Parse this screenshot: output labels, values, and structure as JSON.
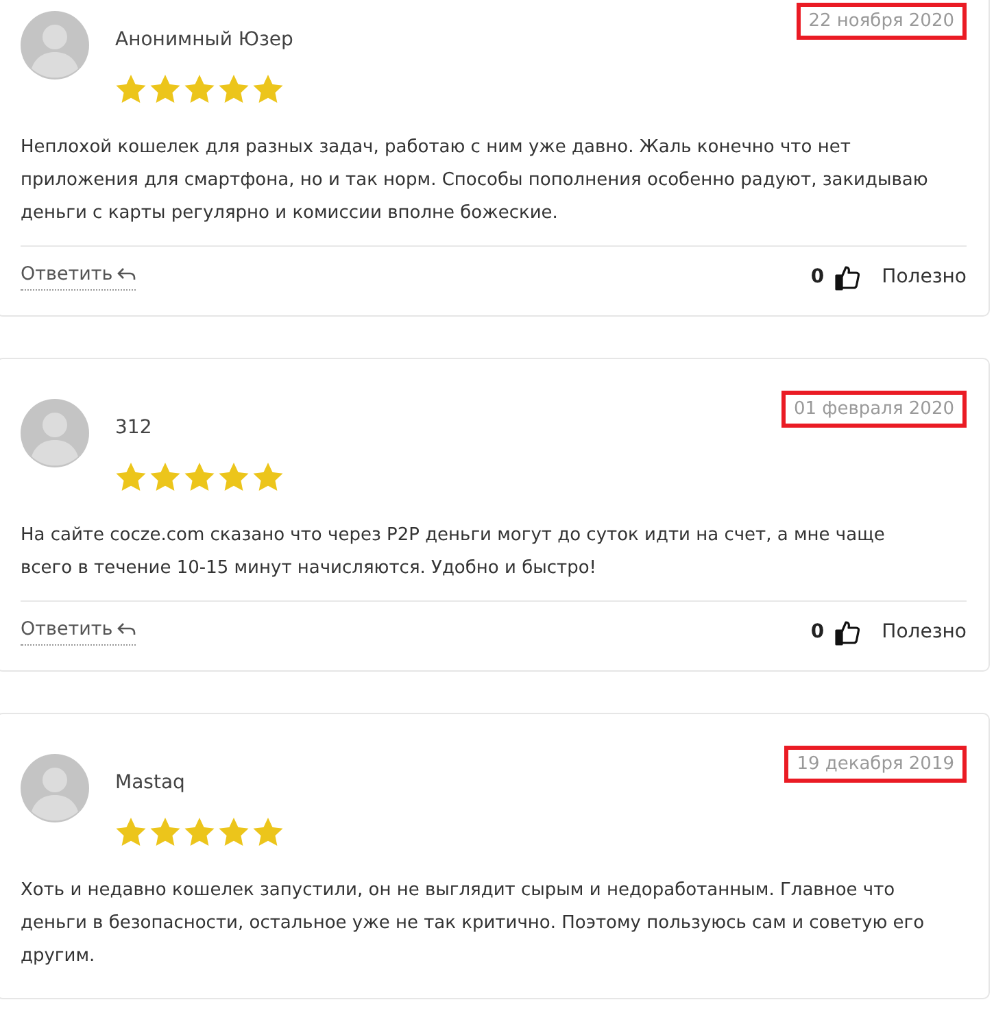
{
  "reviews": [
    {
      "author": "Анонимный Юзер",
      "date": "22 ноября 2020",
      "date_highlighted": true,
      "stars": 5,
      "text": "Неплохой кошелек для разных задач, работаю с ним уже давно. Жаль конечно что нет приложения для смартфона, но и так норм. Способы пополнения особенно радуют, закидываю деньги с карты регулярно и комиссии вполне божеские.",
      "reply": "Ответить",
      "likes": "0",
      "helpful": "Полезно"
    },
    {
      "author": "312",
      "date": "01 февраля 2020",
      "date_highlighted": true,
      "stars": 5,
      "text": "На сайте cocze.com сказано что через P2P деньги могут до суток идти на счет, а мне чаще всего в течение 10-15 минут начисляются. Удобно и быстро!",
      "reply": "Ответить",
      "likes": "0",
      "helpful": "Полезно"
    },
    {
      "author": "Mastaq",
      "date": "19 декабря 2019",
      "date_highlighted": true,
      "stars": 5,
      "text": "Хоть и недавно кошелек запустили, он не выглядит сырым и недоработанным. Главное что деньги в безопасности, остальное уже не так критично. Поэтому пользуюсь сам и советую его другим."
    }
  ]
}
